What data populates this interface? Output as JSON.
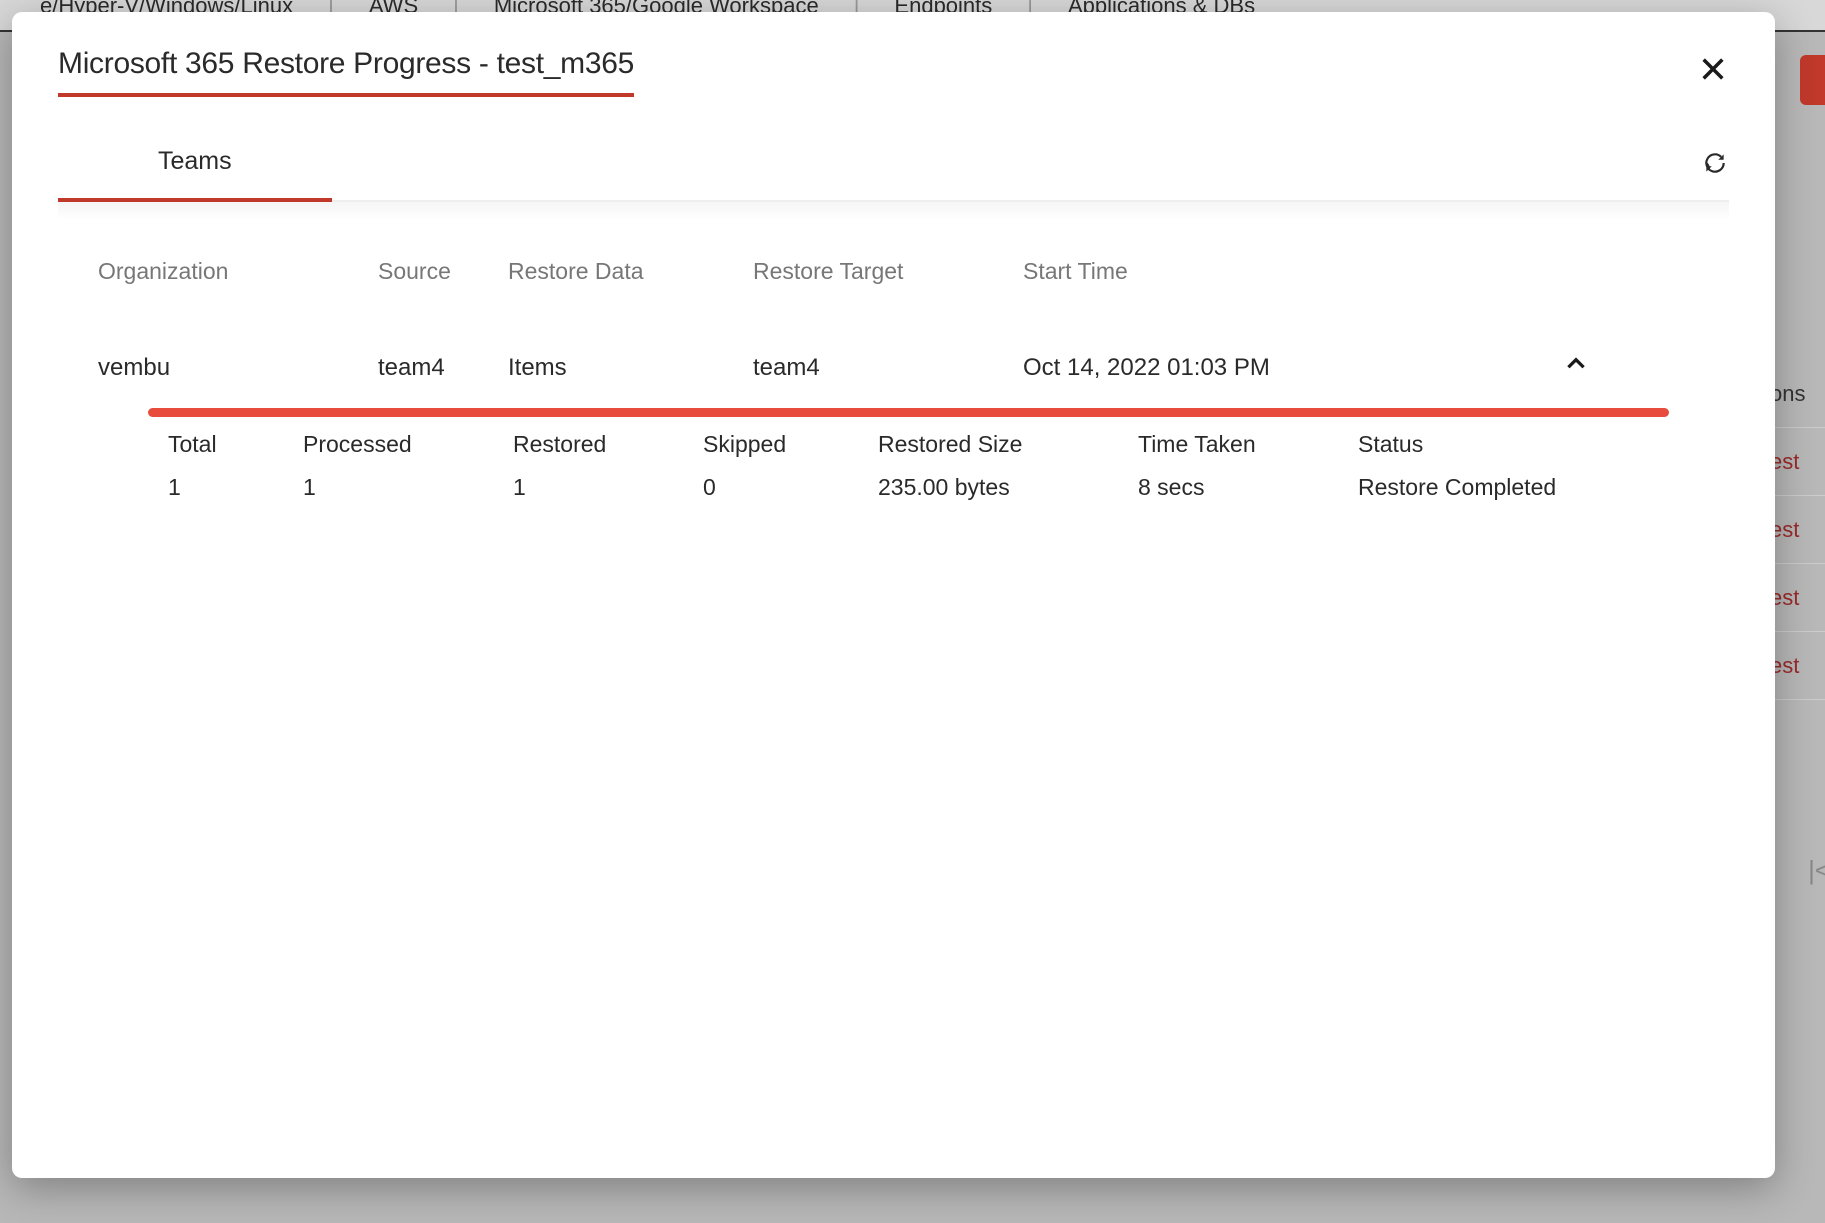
{
  "background": {
    "nav": [
      "e/Hyper-V/Windows/Linux",
      "AWS",
      "Microsoft 365/Google Workspace",
      "Endpoints",
      "Applications & DBs"
    ],
    "right_header": "ons",
    "right_rows": [
      "est",
      "est",
      "est",
      "est"
    ],
    "pager": "|<"
  },
  "modal": {
    "title": "Microsoft 365 Restore Progress - test_m365",
    "tabs": [
      {
        "label": "Teams",
        "active": true
      }
    ],
    "columns": {
      "organization": "Organization",
      "source": "Source",
      "restore_data": "Restore Data",
      "restore_target": "Restore Target",
      "start_time": "Start Time"
    },
    "row": {
      "organization": "vembu",
      "source": "team4",
      "restore_data": "Items",
      "restore_target": "team4",
      "start_time": "Oct 14, 2022 01:03 PM",
      "progress_percent": 100
    },
    "detail_columns": {
      "total": "Total",
      "processed": "Processed",
      "restored": "Restored",
      "skipped": "Skipped",
      "restored_size": "Restored Size",
      "time_taken": "Time Taken",
      "status": "Status"
    },
    "detail_row": {
      "total": "1",
      "processed": "1",
      "restored": "1",
      "skipped": "0",
      "restored_size": "235.00 bytes",
      "time_taken": "8 secs",
      "status": "Restore Completed"
    }
  }
}
